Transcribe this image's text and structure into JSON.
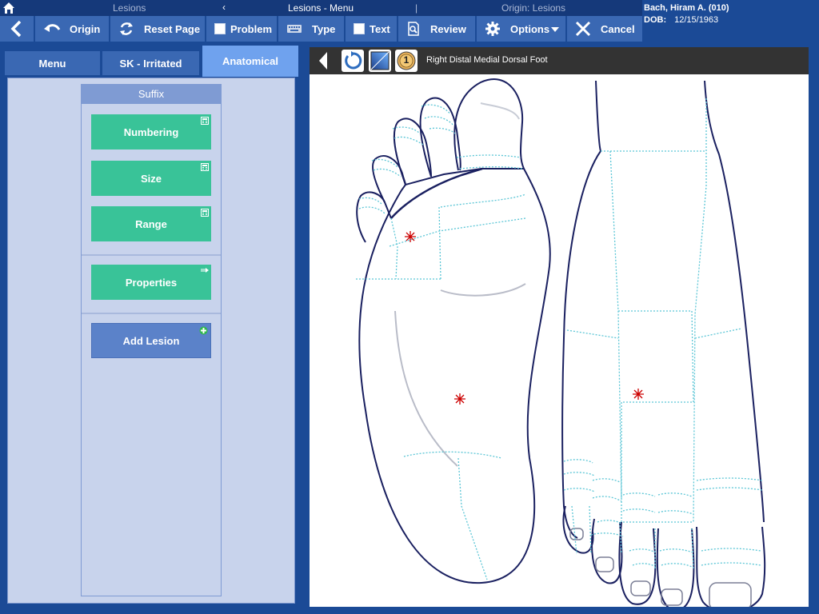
{
  "crumbs": {
    "left": "Lesions",
    "arrow": "‹",
    "center": "Lesions - Menu",
    "divider": "|",
    "right": "Origin: Lesions"
  },
  "toolbar": {
    "origin": "Origin",
    "reset": "Reset Page",
    "problem": "Problem",
    "type": "Type",
    "text": "Text",
    "review": "Review",
    "options": "Options",
    "cancel": "Cancel"
  },
  "patient": {
    "name": "Bach, Hiram A. (010)",
    "dob_label": "DOB:",
    "dob": "12/15/1963"
  },
  "tabs": {
    "menu": "Menu",
    "sk": "SK - Irritated",
    "anatomical": "Anatomical"
  },
  "suffix": {
    "header": "Suffix",
    "numbering": "Numbering",
    "size": "Size",
    "range": "Range",
    "properties": "Properties",
    "add_lesion": "Add Lesion"
  },
  "image": {
    "title": "Right Distal Medial Dorsal Foot",
    "badge": "1"
  },
  "colors": {
    "accent": "#1b4a96",
    "button": "#3a68b3",
    "green": "#39c398",
    "active_tab": "#6fa2ee",
    "marker": "#cc0000"
  },
  "icons": [
    "home-icon",
    "back-chevron-icon",
    "undo-icon",
    "refresh-icon",
    "checkbox-icon",
    "keyboard-icon",
    "review-search-icon",
    "gear-icon",
    "dropdown-icon",
    "close-x-icon",
    "calculator-icon",
    "arrow-right-icon",
    "plus-icon",
    "rotate-icon",
    "gradient-icon",
    "number-badge-icon"
  ]
}
